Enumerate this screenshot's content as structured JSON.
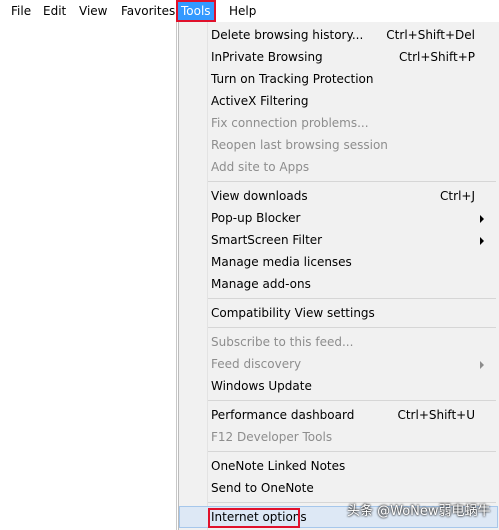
{
  "menubar": {
    "items": [
      "File",
      "Edit",
      "View",
      "Favorites",
      "Tools",
      "Help"
    ]
  },
  "tools_menu": {
    "items": [
      {
        "label": "Delete browsing history...",
        "shortcut": "Ctrl+Shift+Del"
      },
      {
        "label": "InPrivate Browsing",
        "shortcut": "Ctrl+Shift+P"
      },
      {
        "label": "Turn on Tracking Protection",
        "shortcut": ""
      },
      {
        "label": "ActiveX Filtering",
        "shortcut": ""
      },
      {
        "label": "Fix connection problems...",
        "shortcut": ""
      },
      {
        "label": "Reopen last browsing session",
        "shortcut": ""
      },
      {
        "label": "Add site to Apps",
        "shortcut": ""
      },
      {
        "label": "View downloads",
        "shortcut": "Ctrl+J"
      },
      {
        "label": "Pop-up Blocker",
        "shortcut": ""
      },
      {
        "label": "SmartScreen Filter",
        "shortcut": ""
      },
      {
        "label": "Manage media licenses",
        "shortcut": ""
      },
      {
        "label": "Manage add-ons",
        "shortcut": ""
      },
      {
        "label": "Compatibility View settings",
        "shortcut": ""
      },
      {
        "label": "Subscribe to this feed...",
        "shortcut": ""
      },
      {
        "label": "Feed discovery",
        "shortcut": ""
      },
      {
        "label": "Windows Update",
        "shortcut": ""
      },
      {
        "label": "Performance dashboard",
        "shortcut": "Ctrl+Shift+U"
      },
      {
        "label": "F12 Developer Tools",
        "shortcut": ""
      },
      {
        "label": "OneNote Linked Notes",
        "shortcut": ""
      },
      {
        "label": "Send to OneNote",
        "shortcut": ""
      },
      {
        "label": "Internet options",
        "shortcut": ""
      }
    ]
  },
  "watermark": "头条 @WoNew弱电蜗牛",
  "colors": {
    "menu_active": "#3399ff",
    "callout_red": "#e0112b",
    "disabled_text": "#8d8d8d",
    "menu_background": "#f1f1f1"
  }
}
